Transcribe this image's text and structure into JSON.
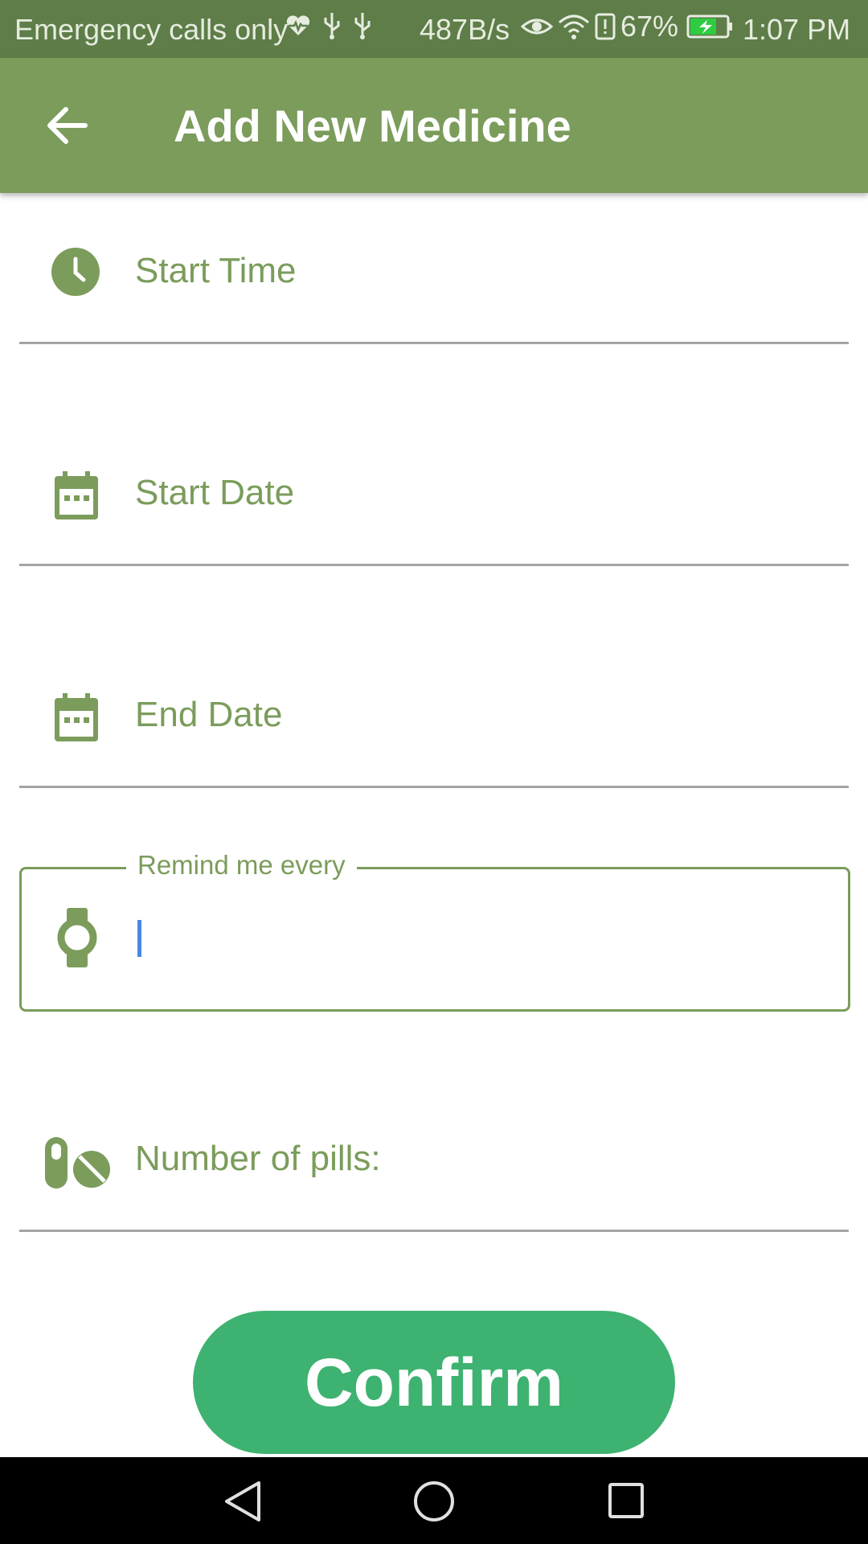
{
  "status_bar": {
    "carrier": "Emergency calls only",
    "net_speed": "487B/s",
    "battery": "67%",
    "time": "1:07 PM",
    "icons": [
      "heart-pulse-icon",
      "usb-icon",
      "usb-icon",
      "eye-icon",
      "wifi-icon",
      "alert-icon",
      "battery-charging-icon"
    ]
  },
  "app_bar": {
    "title": "Add New Medicine",
    "back_icon": "arrow-back-icon",
    "color": "#7b9c5b"
  },
  "form": {
    "start_time": {
      "label": "Start Time",
      "icon": "clock-icon"
    },
    "start_date": {
      "label": "Start Date",
      "icon": "calendar-icon"
    },
    "end_date": {
      "label": "End Date",
      "icon": "calendar-icon"
    },
    "remind_every": {
      "label": "Remind me every",
      "value": "",
      "icon": "watch-icon"
    },
    "pills": {
      "label": "Number of pills:",
      "icon": "pills-icon"
    }
  },
  "confirm_button": {
    "label": "Confirm",
    "color": "#3eb270"
  },
  "nav_bar": {
    "icons": [
      "back-triangle-icon",
      "home-circle-icon",
      "recents-square-icon"
    ]
  },
  "colors": {
    "accent": "#7b9c5b",
    "status_bar": "#5e7d48",
    "cursor": "#4a86e8"
  }
}
